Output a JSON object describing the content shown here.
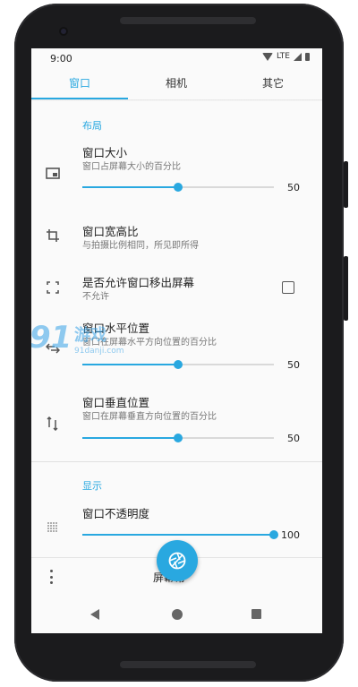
{
  "status_bar": {
    "time": "9:00",
    "network": "LTE"
  },
  "tabs": [
    {
      "label": "窗口",
      "active": true
    },
    {
      "label": "相机",
      "active": false
    },
    {
      "label": "其它",
      "active": false
    }
  ],
  "sections": {
    "layout_header": "布局",
    "display_header": "显示"
  },
  "settings": {
    "window_size": {
      "title": "窗口大小",
      "subtitle": "窗口占屏幕大小的百分比",
      "value": "50",
      "level": 0.5,
      "icon": "picture-in-picture-icon"
    },
    "aspect_ratio": {
      "title": "窗口宽高比",
      "subtitle": "与拍摄比例相同，所见即所得",
      "icon": "crop-icon"
    },
    "allow_offscreen": {
      "title": "是否允许窗口移出屏幕",
      "subtitle": "不允许",
      "checked": false,
      "icon": "fullscreen-icon"
    },
    "horizontal_position": {
      "title": "窗口水平位置",
      "subtitle": "窗口在屏幕水平方向位置的百分比",
      "value": "50",
      "level": 0.5,
      "icon": "swap-horizontal-icon"
    },
    "vertical_position": {
      "title": "窗口垂直位置",
      "subtitle": "窗口在屏幕垂直方向位置的百分比",
      "value": "50",
      "level": 0.5,
      "icon": "swap-vertical-icon"
    },
    "opacity": {
      "title": "窗口不透明度",
      "value": "100",
      "level": 1.0,
      "icon": "grid-dots-icon"
    }
  },
  "bottom_bar": {
    "label": "屏幕常"
  },
  "watermark": {
    "brand": "91游戏",
    "url": "91danji.com"
  },
  "colors": {
    "accent": "#29a8e0",
    "background": "#fafafa",
    "phone": "#1b1b1d"
  }
}
